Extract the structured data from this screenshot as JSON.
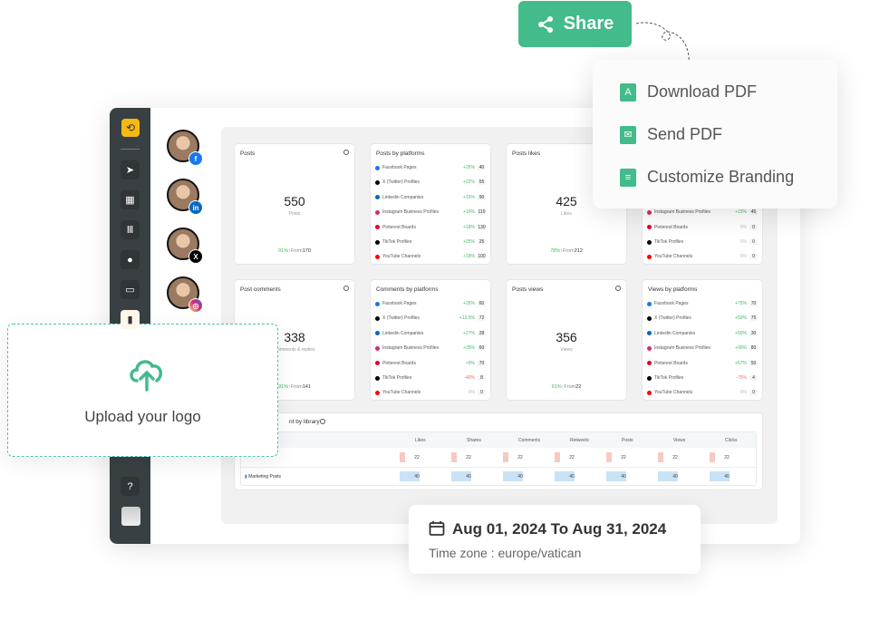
{
  "share": {
    "label": "Share",
    "icon": "share-icon"
  },
  "menu": [
    {
      "label": "Download PDF",
      "icon": "pdf-icon"
    },
    {
      "label": "Send PDF",
      "icon": "send-mail-icon"
    },
    {
      "label": "Customize Branding",
      "icon": "branding-icon"
    }
  ],
  "sidebar": {
    "items": [
      "send-icon",
      "calendar-icon",
      "library-icon",
      "user-icon",
      "inbox-icon",
      "analytics-icon",
      "help-icon"
    ]
  },
  "accounts": [
    {
      "network": "facebook",
      "color": "#1877f2",
      "glyph": "f"
    },
    {
      "network": "linkedin",
      "color": "#0a66c2",
      "glyph": "in"
    },
    {
      "network": "x",
      "color": "#000000",
      "glyph": "X"
    },
    {
      "network": "instagram",
      "color": "#d62976",
      "glyph": "◎"
    }
  ],
  "cards": {
    "posts": {
      "title": "Posts",
      "value": "550",
      "unit": "Posts",
      "change": "91%↑",
      "from_label": "From",
      "from": "170"
    },
    "likes": {
      "title": "Posts likes",
      "value": "425",
      "unit": "Likes",
      "change": "78%↑",
      "from_label": "From",
      "from": "212"
    },
    "comments": {
      "title": "Post comments",
      "value": "338",
      "unit": "Comments & replies",
      "change": "91%↑",
      "from_label": "From",
      "from": "141"
    },
    "views": {
      "title": "Posts views",
      "value": "356",
      "unit": "Views",
      "change": "91%↑",
      "from_label": "From",
      "from": "22"
    }
  },
  "platforms": {
    "posts": {
      "title": "Posts by platforms",
      "rows": [
        [
          "Facebook Pages",
          "+25%",
          "40"
        ],
        [
          "X (Twitter) Profiles",
          "+22%",
          "55"
        ],
        [
          "Linkedin Companies",
          "+15%",
          "90"
        ],
        [
          "Instagram Business Profiles",
          "+16%",
          "110"
        ],
        [
          "Pinterest Boards",
          "+18%",
          "130"
        ],
        [
          "TikTok Profiles",
          "+25%",
          "25"
        ],
        [
          "YouTube Channels",
          "+18%",
          "100"
        ]
      ]
    },
    "likes": {
      "title": "",
      "rows": [
        [
          "Instagram Business Profiles",
          "+15%",
          "45"
        ],
        [
          "Pinterest Boards",
          "0%",
          "0"
        ],
        [
          "TikTok Profiles",
          "0%",
          "0"
        ],
        [
          "YouTube Channels",
          "0%",
          "0"
        ]
      ]
    },
    "comments": {
      "title": "Comments by platforms",
      "rows": [
        [
          "Facebook Pages",
          "+25%",
          "60"
        ],
        [
          "X (Twitter) Profiles",
          "+12.5%",
          "72"
        ],
        [
          "Linkedin Companies",
          "+27%",
          "28"
        ],
        [
          "Instagram Business Profiles",
          "+25%",
          "60"
        ],
        [
          "Pinterest Boards",
          "+9%",
          "70"
        ],
        [
          "TikTok Profiles",
          "-40%",
          "8"
        ],
        [
          "YouTube Channels",
          "0%",
          "0"
        ]
      ]
    },
    "views": {
      "title": "Views by platforms",
      "rows": [
        [
          "Facebook Pages",
          "+75%",
          "70"
        ],
        [
          "X (Twitter) Profiles",
          "+50%",
          "75"
        ],
        [
          "Linkedin Companies",
          "+50%",
          "30"
        ],
        [
          "Instagram Business Profiles",
          "+90%",
          "80"
        ],
        [
          "Pinterest Boards",
          "+67%",
          "50"
        ],
        [
          "TikTok Profiles",
          "-75%",
          "4"
        ],
        [
          "YouTube Channels",
          "0%",
          "0"
        ]
      ]
    }
  },
  "platform_colors": {
    "Facebook Pages": "#1877f2",
    "X (Twitter) Profiles": "#000000",
    "Linkedin Companies": "#0a66c2",
    "Instagram Business Profiles": "#d62976",
    "Pinterest Boards": "#e60023",
    "TikTok Profiles": "#000000",
    "YouTube Channels": "#ff0000"
  },
  "library": {
    "title": "nt by library",
    "columns": [
      "Likes",
      "Shares",
      "Comments",
      "Retweets",
      "Posts",
      "Views",
      "Clicks"
    ],
    "rows": [
      {
        "name": "",
        "values": [
          "22",
          "22",
          "22",
          "22",
          "22",
          "22",
          "22"
        ],
        "color": "#f7c9c5"
      },
      {
        "name": "Marketing Posts",
        "values": [
          "40",
          "40",
          "40",
          "40",
          "40",
          "40",
          "40"
        ],
        "color": "#c9e2f5"
      }
    ]
  },
  "upload": {
    "label": "Upload your logo",
    "icon": "cloud-upload-icon"
  },
  "date": {
    "range": "Aug 01, 2024 To Aug 31, 2024",
    "timezone": "Time zone : europe/vatican"
  }
}
